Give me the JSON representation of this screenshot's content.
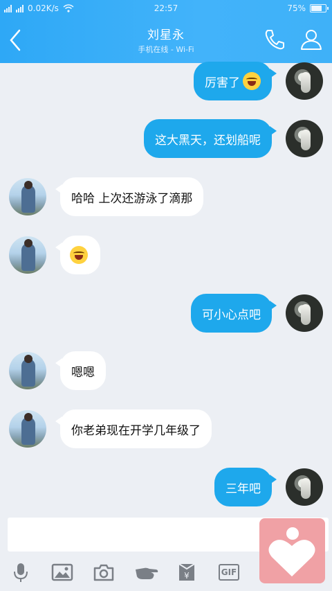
{
  "status_bar": {
    "network": "4G",
    "speed": "0.02K/s",
    "time": "22:57",
    "battery": "75%",
    "battery_level": 0.75
  },
  "header": {
    "title": "刘星永",
    "subtitle": "手机在线 - Wi-Fi",
    "back_icon": "chevron-left-icon",
    "call_icon": "phone-icon",
    "profile_icon": "person-icon"
  },
  "messages": [
    {
      "from": "me",
      "text": "厉害了",
      "emoji": true
    },
    {
      "from": "me",
      "text": "这大黑天，还划船呢",
      "emoji": false
    },
    {
      "from": "other",
      "text": "哈哈  上次还游泳了滴那",
      "emoji": false
    },
    {
      "from": "other",
      "text": "",
      "emoji": true
    },
    {
      "from": "me",
      "text": "可小心点吧",
      "emoji": false
    },
    {
      "from": "other",
      "text": "嗯嗯",
      "emoji": false
    },
    {
      "from": "other",
      "text": "你老弟现在开学几年级了",
      "emoji": false
    },
    {
      "from": "me",
      "text": "三年吧",
      "emoji": false
    }
  ],
  "input": {
    "value": "",
    "placeholder": ""
  },
  "toolbar": {
    "items": [
      "microphone-icon",
      "image-icon",
      "camera-icon",
      "hand-icon",
      "red-packet-icon",
      "gif-icon"
    ],
    "gif_label": "GIF"
  },
  "colors": {
    "header": "#3aaff8",
    "bubble_me": "#1ea8ec",
    "bubble_other": "#ffffff",
    "background": "#eceff4",
    "floating_app": "#f0a1a5"
  }
}
